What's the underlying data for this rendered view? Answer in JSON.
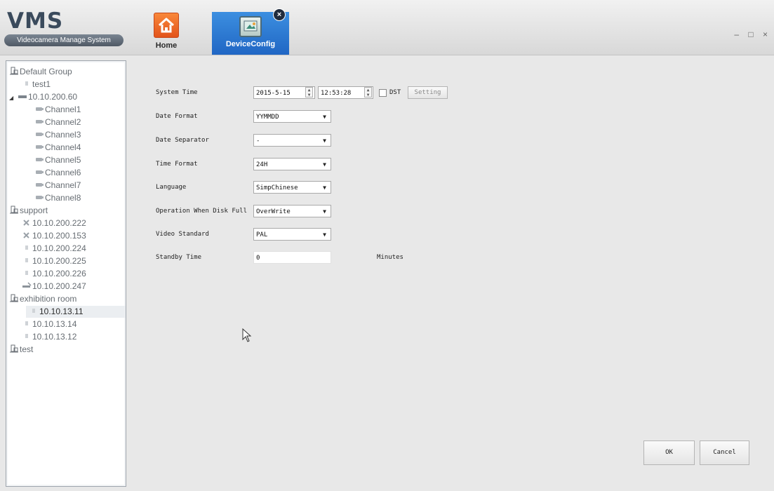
{
  "app": {
    "title": "VMS",
    "subtitle": "Videocamera Manage System"
  },
  "tabs": [
    {
      "label": "Home",
      "icon": "home-icon"
    },
    {
      "label": "DeviceConfig",
      "icon": "device-config-icon",
      "active": true,
      "close": "×"
    }
  ],
  "window_controls": "– □ ×",
  "tree": [
    {
      "label": "Default Group",
      "icon": "group-icon"
    },
    {
      "label": "test1",
      "icon": "device-icon"
    },
    {
      "label": "10.10.200.60",
      "icon": "dvr-icon",
      "expanded": true
    },
    {
      "label": "Channel1",
      "icon": "camera-icon"
    },
    {
      "label": "Channel2",
      "icon": "camera-icon"
    },
    {
      "label": "Channel3",
      "icon": "camera-icon"
    },
    {
      "label": "Channel4",
      "icon": "camera-icon"
    },
    {
      "label": "Channel5",
      "icon": "camera-icon"
    },
    {
      "label": "Channel6",
      "icon": "camera-icon"
    },
    {
      "label": "Channel7",
      "icon": "camera-icon"
    },
    {
      "label": "Channel8",
      "icon": "camera-icon"
    },
    {
      "label": "support",
      "icon": "group-icon"
    },
    {
      "label": "10.10.200.222",
      "icon": "device-offline-icon"
    },
    {
      "label": "10.10.200.153",
      "icon": "device-offline-icon"
    },
    {
      "label": "10.10.200.224",
      "icon": "device-icon"
    },
    {
      "label": "10.10.200.225",
      "icon": "device-icon"
    },
    {
      "label": "10.10.200.226",
      "icon": "device-icon"
    },
    {
      "label": "10.10.200.247",
      "icon": "dvr-offline-icon"
    },
    {
      "label": "exhibition room",
      "icon": "group-icon"
    },
    {
      "label": "10.10.13.11",
      "icon": "device-icon",
      "selected": true
    },
    {
      "label": "10.10.13.14",
      "icon": "device-icon"
    },
    {
      "label": "10.10.13.12",
      "icon": "device-icon"
    },
    {
      "label": "test",
      "icon": "group-icon"
    }
  ],
  "form": {
    "system_time": {
      "label": "System Time",
      "date": "2015-5-15",
      "time": "12:53:28",
      "dst_label": "DST",
      "dst_checked": false,
      "setting_button": "Setting"
    },
    "date_format": {
      "label": "Date Format",
      "value": "YYMMDD"
    },
    "date_separator": {
      "label": "Date Separator",
      "value": "-"
    },
    "time_format": {
      "label": "Time Format",
      "value": "24H"
    },
    "language": {
      "label": "Language",
      "value": "SimpChinese"
    },
    "disk_full": {
      "label": "Operation When Disk Full",
      "value": "OverWrite"
    },
    "video_standard": {
      "label": "Video Standard",
      "value": "PAL"
    },
    "standby_time": {
      "label": "Standby Time",
      "value": "0",
      "unit": "Minutes"
    }
  },
  "buttons": {
    "ok": "OK",
    "cancel": "Cancel"
  },
  "colors": {
    "active_tab": "#2a75d0",
    "home_icon": "#f0702a",
    "selection": "#ebeef1"
  }
}
